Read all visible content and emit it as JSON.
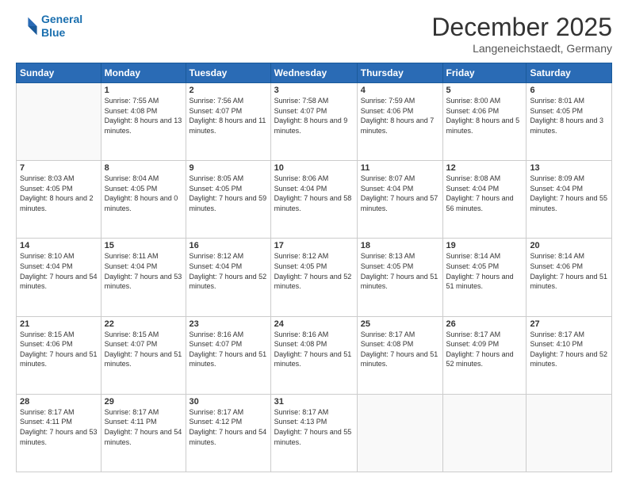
{
  "header": {
    "logo_line1": "General",
    "logo_line2": "Blue",
    "month": "December 2025",
    "location": "Langeneichstaedt, Germany"
  },
  "weekdays": [
    "Sunday",
    "Monday",
    "Tuesday",
    "Wednesday",
    "Thursday",
    "Friday",
    "Saturday"
  ],
  "weeks": [
    [
      {
        "day": "",
        "sunrise": "",
        "sunset": "",
        "daylight": ""
      },
      {
        "day": "1",
        "sunrise": "Sunrise: 7:55 AM",
        "sunset": "Sunset: 4:08 PM",
        "daylight": "Daylight: 8 hours and 13 minutes."
      },
      {
        "day": "2",
        "sunrise": "Sunrise: 7:56 AM",
        "sunset": "Sunset: 4:07 PM",
        "daylight": "Daylight: 8 hours and 11 minutes."
      },
      {
        "day": "3",
        "sunrise": "Sunrise: 7:58 AM",
        "sunset": "Sunset: 4:07 PM",
        "daylight": "Daylight: 8 hours and 9 minutes."
      },
      {
        "day": "4",
        "sunrise": "Sunrise: 7:59 AM",
        "sunset": "Sunset: 4:06 PM",
        "daylight": "Daylight: 8 hours and 7 minutes."
      },
      {
        "day": "5",
        "sunrise": "Sunrise: 8:00 AM",
        "sunset": "Sunset: 4:06 PM",
        "daylight": "Daylight: 8 hours and 5 minutes."
      },
      {
        "day": "6",
        "sunrise": "Sunrise: 8:01 AM",
        "sunset": "Sunset: 4:05 PM",
        "daylight": "Daylight: 8 hours and 3 minutes."
      }
    ],
    [
      {
        "day": "7",
        "sunrise": "Sunrise: 8:03 AM",
        "sunset": "Sunset: 4:05 PM",
        "daylight": "Daylight: 8 hours and 2 minutes."
      },
      {
        "day": "8",
        "sunrise": "Sunrise: 8:04 AM",
        "sunset": "Sunset: 4:05 PM",
        "daylight": "Daylight: 8 hours and 0 minutes."
      },
      {
        "day": "9",
        "sunrise": "Sunrise: 8:05 AM",
        "sunset": "Sunset: 4:05 PM",
        "daylight": "Daylight: 7 hours and 59 minutes."
      },
      {
        "day": "10",
        "sunrise": "Sunrise: 8:06 AM",
        "sunset": "Sunset: 4:04 PM",
        "daylight": "Daylight: 7 hours and 58 minutes."
      },
      {
        "day": "11",
        "sunrise": "Sunrise: 8:07 AM",
        "sunset": "Sunset: 4:04 PM",
        "daylight": "Daylight: 7 hours and 57 minutes."
      },
      {
        "day": "12",
        "sunrise": "Sunrise: 8:08 AM",
        "sunset": "Sunset: 4:04 PM",
        "daylight": "Daylight: 7 hours and 56 minutes."
      },
      {
        "day": "13",
        "sunrise": "Sunrise: 8:09 AM",
        "sunset": "Sunset: 4:04 PM",
        "daylight": "Daylight: 7 hours and 55 minutes."
      }
    ],
    [
      {
        "day": "14",
        "sunrise": "Sunrise: 8:10 AM",
        "sunset": "Sunset: 4:04 PM",
        "daylight": "Daylight: 7 hours and 54 minutes."
      },
      {
        "day": "15",
        "sunrise": "Sunrise: 8:11 AM",
        "sunset": "Sunset: 4:04 PM",
        "daylight": "Daylight: 7 hours and 53 minutes."
      },
      {
        "day": "16",
        "sunrise": "Sunrise: 8:12 AM",
        "sunset": "Sunset: 4:04 PM",
        "daylight": "Daylight: 7 hours and 52 minutes."
      },
      {
        "day": "17",
        "sunrise": "Sunrise: 8:12 AM",
        "sunset": "Sunset: 4:05 PM",
        "daylight": "Daylight: 7 hours and 52 minutes."
      },
      {
        "day": "18",
        "sunrise": "Sunrise: 8:13 AM",
        "sunset": "Sunset: 4:05 PM",
        "daylight": "Daylight: 7 hours and 51 minutes."
      },
      {
        "day": "19",
        "sunrise": "Sunrise: 8:14 AM",
        "sunset": "Sunset: 4:05 PM",
        "daylight": "Daylight: 7 hours and 51 minutes."
      },
      {
        "day": "20",
        "sunrise": "Sunrise: 8:14 AM",
        "sunset": "Sunset: 4:06 PM",
        "daylight": "Daylight: 7 hours and 51 minutes."
      }
    ],
    [
      {
        "day": "21",
        "sunrise": "Sunrise: 8:15 AM",
        "sunset": "Sunset: 4:06 PM",
        "daylight": "Daylight: 7 hours and 51 minutes."
      },
      {
        "day": "22",
        "sunrise": "Sunrise: 8:15 AM",
        "sunset": "Sunset: 4:07 PM",
        "daylight": "Daylight: 7 hours and 51 minutes."
      },
      {
        "day": "23",
        "sunrise": "Sunrise: 8:16 AM",
        "sunset": "Sunset: 4:07 PM",
        "daylight": "Daylight: 7 hours and 51 minutes."
      },
      {
        "day": "24",
        "sunrise": "Sunrise: 8:16 AM",
        "sunset": "Sunset: 4:08 PM",
        "daylight": "Daylight: 7 hours and 51 minutes."
      },
      {
        "day": "25",
        "sunrise": "Sunrise: 8:17 AM",
        "sunset": "Sunset: 4:08 PM",
        "daylight": "Daylight: 7 hours and 51 minutes."
      },
      {
        "day": "26",
        "sunrise": "Sunrise: 8:17 AM",
        "sunset": "Sunset: 4:09 PM",
        "daylight": "Daylight: 7 hours and 52 minutes."
      },
      {
        "day": "27",
        "sunrise": "Sunrise: 8:17 AM",
        "sunset": "Sunset: 4:10 PM",
        "daylight": "Daylight: 7 hours and 52 minutes."
      }
    ],
    [
      {
        "day": "28",
        "sunrise": "Sunrise: 8:17 AM",
        "sunset": "Sunset: 4:11 PM",
        "daylight": "Daylight: 7 hours and 53 minutes."
      },
      {
        "day": "29",
        "sunrise": "Sunrise: 8:17 AM",
        "sunset": "Sunset: 4:11 PM",
        "daylight": "Daylight: 7 hours and 54 minutes."
      },
      {
        "day": "30",
        "sunrise": "Sunrise: 8:17 AM",
        "sunset": "Sunset: 4:12 PM",
        "daylight": "Daylight: 7 hours and 54 minutes."
      },
      {
        "day": "31",
        "sunrise": "Sunrise: 8:17 AM",
        "sunset": "Sunset: 4:13 PM",
        "daylight": "Daylight: 7 hours and 55 minutes."
      },
      {
        "day": "",
        "sunrise": "",
        "sunset": "",
        "daylight": ""
      },
      {
        "day": "",
        "sunrise": "",
        "sunset": "",
        "daylight": ""
      },
      {
        "day": "",
        "sunrise": "",
        "sunset": "",
        "daylight": ""
      }
    ]
  ]
}
